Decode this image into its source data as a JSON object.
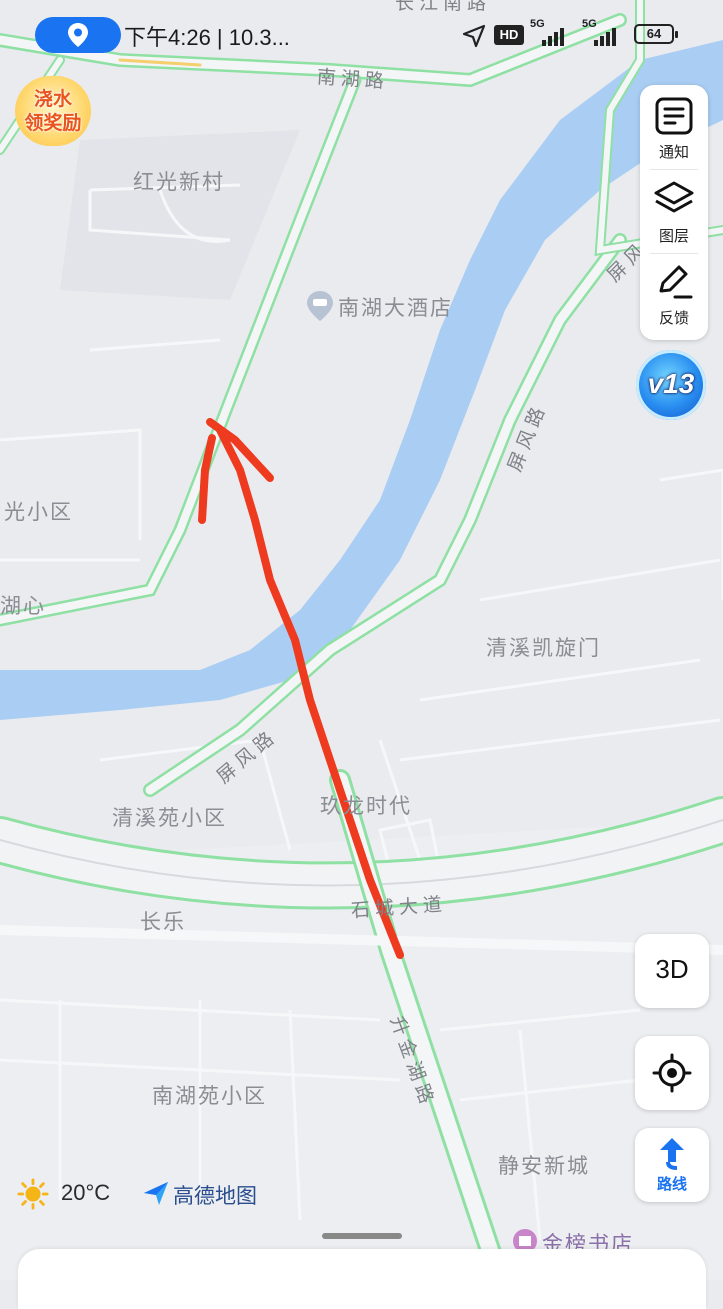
{
  "status_bar": {
    "time": "下午4:26 | 10.3...",
    "battery": "64",
    "network_1": "5G",
    "network_2": "5G",
    "hd_badge": "HD"
  },
  "promo": {
    "line1": "浇水",
    "line2": "领奖励"
  },
  "map_labels": {
    "hongguang": "红光新村",
    "hotel": "南湖大酒店",
    "guang_xiaoqu": "光小区",
    "huxin": "湖心",
    "qingxi_kaixuanmen": "清溪凯旋门",
    "qingxiyuan": "清溪苑小区",
    "jiulong": "玖龙时代",
    "changle": "长乐",
    "nanhuyuan": "南湖苑小区",
    "jingan": "静安新城",
    "bookstore": "金榜书店",
    "changjiang": "长江南路",
    "nanhu_road": "南湖路",
    "pingfeng_top": "屏风",
    "pingfeng_mid": "屏风路",
    "pingfeng_low": "屏风路",
    "shicheng": "石城大道",
    "shengjinhu": "升金湖路"
  },
  "right_panel": {
    "notify": "通知",
    "layers": "图层",
    "feedback": "反馈",
    "badge": "v13",
    "btn_3d": "3D",
    "route": "路线"
  },
  "bottom": {
    "temperature": "20°C",
    "brand": "高德地图"
  },
  "icons": [
    "location-pin-icon",
    "navigation-arrow-icon",
    "signal-icon",
    "notification-icon",
    "layers-icon",
    "feedback-edit-icon",
    "locate-icon",
    "route-arrow-icon",
    "sun-icon",
    "amap-logo-icon",
    "hotel-icon",
    "bookstore-icon"
  ],
  "colors": {
    "road_green": "#8ee0a3",
    "river": "#a9cdf3",
    "annotation": "#ee3a1f",
    "accent": "#1a73f0"
  }
}
